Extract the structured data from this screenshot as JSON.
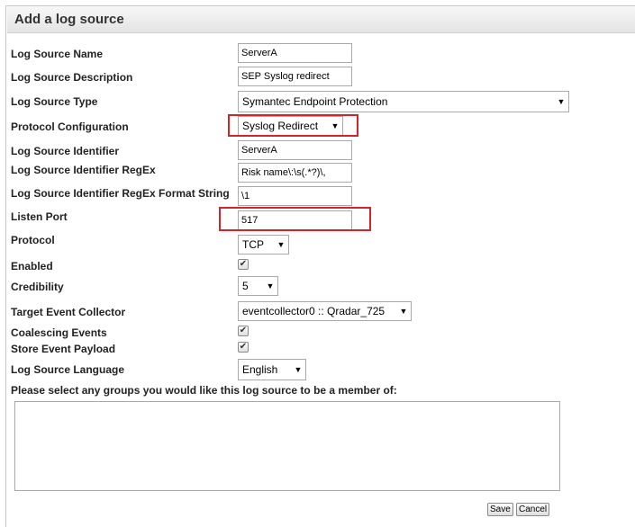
{
  "dialog": {
    "title": "Add a log source"
  },
  "form": {
    "log_source_name": {
      "label": "Log Source Name",
      "value": "ServerA"
    },
    "log_source_description": {
      "label": "Log Source Description",
      "value": "SEP Syslog redirect"
    },
    "log_source_type": {
      "label": "Log Source Type",
      "value": "Symantec Endpoint Protection"
    },
    "protocol_configuration": {
      "label": "Protocol Configuration",
      "value": "Syslog Redirect"
    },
    "log_source_identifier": {
      "label": "Log Source Identifier",
      "value": "ServerA"
    },
    "identifier_regex": {
      "label": "Log Source Identifier RegEx",
      "value": "Risk name\\:\\s(.*?)\\,"
    },
    "identifier_regex_format": {
      "label": "Log Source Identifier RegEx Format String",
      "value": "\\1"
    },
    "listen_port": {
      "label": "Listen Port",
      "value": "517"
    },
    "protocol": {
      "label": "Protocol",
      "value": "TCP"
    },
    "enabled": {
      "label": "Enabled",
      "checked": true
    },
    "credibility": {
      "label": "Credibility",
      "value": "5"
    },
    "target_event_collector": {
      "label": "Target Event Collector",
      "value": "eventcollector0 :: Qradar_725"
    },
    "coalescing_events": {
      "label": "Coalescing Events",
      "checked": true
    },
    "store_event_payload": {
      "label": "Store Event Payload",
      "checked": true
    },
    "log_source_language": {
      "label": "Log Source Language",
      "value": "English"
    },
    "groups_prompt": "Please select any groups you would like this log source to be a member of:"
  },
  "buttons": {
    "save": "Save",
    "cancel": "Cancel"
  },
  "colors": {
    "highlight": "#d0262b"
  }
}
